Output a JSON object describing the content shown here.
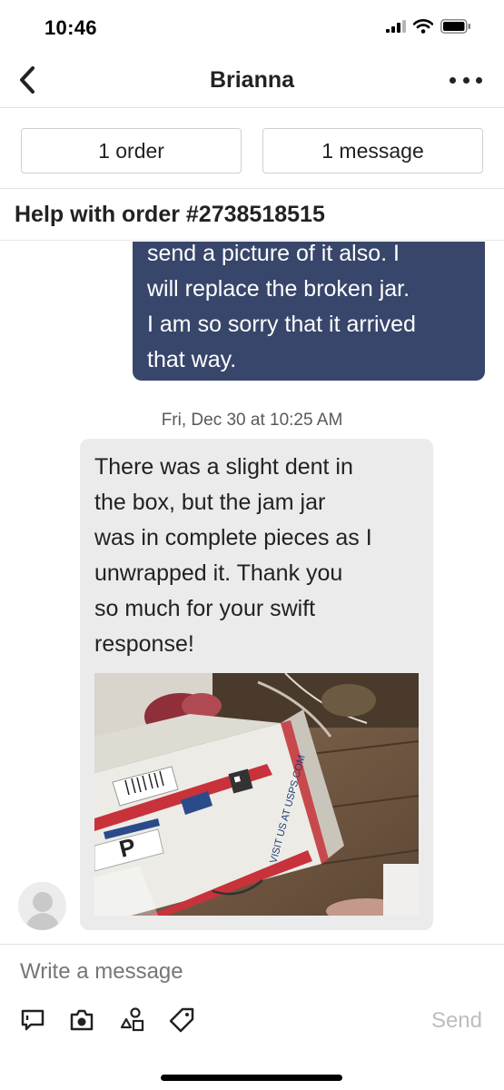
{
  "status_bar": {
    "time": "10:46",
    "icons": [
      "signal-icon",
      "wifi-icon",
      "battery-icon"
    ]
  },
  "header": {
    "title": "Brianna",
    "back_icon": "chevron-left-icon",
    "more_icon": "more-horizontal-icon"
  },
  "summary": {
    "orders_label": "1 order",
    "messages_label": "1 message"
  },
  "subject": {
    "text": "Help with order #2738518515"
  },
  "conversation": {
    "outgoing_message": "send a picture of it also. I\nwill replace the broken jar.\nI am so sorry that it arrived\nthat way.",
    "timestamp": "Fri, Dec 30 at 10:25 AM",
    "incoming_message": "There was a slight dent in\nthe box, but the jam jar\nwas in complete pieces as I\nunwrapped it. Thank you\nso much for your swift\nresponse!",
    "photo_label": "USPS shipping box"
  },
  "compose": {
    "placeholder": "Write a message",
    "send_label": "Send",
    "tools": [
      "review-icon",
      "camera-icon",
      "shapes-icon",
      "tag-icon"
    ]
  },
  "colors": {
    "outgoing_bubble": "#37466a",
    "incoming_bubble": "#ebebeb",
    "send_disabled": "#bdbdbd"
  }
}
